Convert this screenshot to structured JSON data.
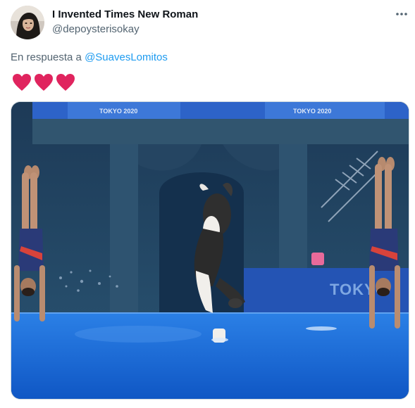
{
  "tweet": {
    "author": {
      "display_name": "I Invented Times New Roman",
      "handle": "@depoysterisokay"
    },
    "reply": {
      "prefix": "En respuesta a",
      "mention": "@SuavesLomitos"
    },
    "emoji": [
      "red-heart",
      "red-heart",
      "red-heart"
    ],
    "media": {
      "banner_left": "TOKYO 2020",
      "banner_right": "TOKYO 2020",
      "wall_text": "TOKYO"
    }
  },
  "colors": {
    "link": "#1d9bf0",
    "secondary_text": "#536471",
    "heart": "#e0245e"
  },
  "icons": [
    "more-horizontal-icon",
    "red-heart-emoji"
  ]
}
